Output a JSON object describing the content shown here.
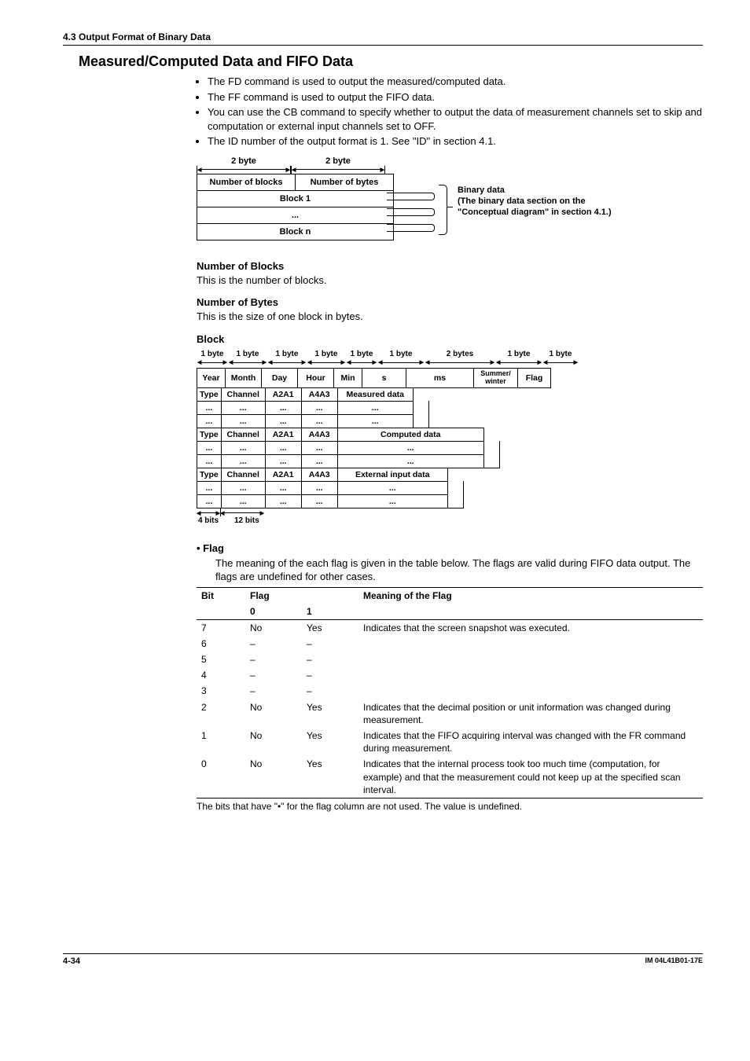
{
  "section_header": "4.3  Output Format of Binary Data",
  "title": "Measured/Computed Data and FIFO Data",
  "bullets": [
    "The FD command is used to output the measured/computed data.",
    "The FF command is used to output the FIFO data.",
    "You can use the CB command to specify whether to output the data of measurement channels set to skip and computation or external input channels set to OFF.",
    "The ID number of the output format is 1.  See \"ID\" in section 4.1."
  ],
  "diagram1": {
    "dim1": "2 byte",
    "dim2": "2 byte",
    "cells": {
      "num_blocks": "Number of blocks",
      "num_bytes": "Number of bytes",
      "block1": "Block 1",
      "dots": "...",
      "blockn": "Block n"
    },
    "brace_label": "Binary data\n(The binary data section on the \"Conceptual diagram\" in section 4.1.)"
  },
  "num_blocks_head": "Number of Blocks",
  "num_blocks_text": "This is the number of blocks.",
  "num_bytes_head": "Number of Bytes",
  "num_bytes_text": "This is the size of one block in bytes.",
  "block_head": "Block",
  "bd_dims": [
    "1 byte",
    "1 byte",
    "1 byte",
    "1 byte",
    "1 byte",
    "1 byte",
    "2 bytes",
    "1 byte",
    "1 byte"
  ],
  "bd_header": [
    "Year",
    "Month",
    "Day",
    "Hour",
    "Min",
    "s",
    "ms",
    "Summer/\nwinter",
    "Flag"
  ],
  "bd_rows": [
    [
      "Type",
      "Channel",
      "A2A1",
      "A4A3",
      "Measured data"
    ],
    [
      "...",
      "...",
      "...",
      "...",
      "..."
    ],
    [
      "...",
      "...",
      "...",
      "...",
      "..."
    ],
    [
      "Type",
      "Channel",
      "A2A1",
      "A4A3",
      "Computed data"
    ],
    [
      "...",
      "...",
      "...",
      "...",
      "..."
    ],
    [
      "...",
      "...",
      "...",
      "...",
      "..."
    ],
    [
      "Type",
      "Channel",
      "A2A1",
      "A4A3",
      "External input data"
    ],
    [
      "...",
      "...",
      "...",
      "...",
      "..."
    ],
    [
      "...",
      "...",
      "...",
      "...",
      "..."
    ]
  ],
  "bd_bottom_left": "4 bits",
  "bd_bottom_right": "12 bits",
  "flag_head": "•  Flag",
  "flag_intro": "The meaning of the each flag is given in the table below.  The flags are valid during FIFO data output.  The flags are undefined for other cases.",
  "flag_table": {
    "cols": [
      "Bit",
      "Flag",
      "",
      "Meaning of the Flag"
    ],
    "subcols": [
      "",
      "0",
      "1",
      ""
    ],
    "rows": [
      {
        "bit": "7",
        "f0": "No",
        "f1": "Yes",
        "meaning": "Indicates that the screen snapshot was executed."
      },
      {
        "bit": "6",
        "f0": "–",
        "f1": "–",
        "meaning": ""
      },
      {
        "bit": "5",
        "f0": "–",
        "f1": "–",
        "meaning": ""
      },
      {
        "bit": "4",
        "f0": "–",
        "f1": "–",
        "meaning": ""
      },
      {
        "bit": "3",
        "f0": "–",
        "f1": "–",
        "meaning": ""
      },
      {
        "bit": "2",
        "f0": "No",
        "f1": "Yes",
        "meaning": "Indicates that the decimal position or unit information was changed during measurement."
      },
      {
        "bit": "1",
        "f0": "No",
        "f1": "Yes",
        "meaning": "Indicates that the FIFO acquiring interval was changed with the FR command during measurement."
      },
      {
        "bit": "0",
        "f0": "No",
        "f1": "Yes",
        "meaning": "Indicates that the internal process took too much time (computation, for example) and that the measurement could not keep up at the specified scan interval."
      }
    ]
  },
  "flag_footnote": "The bits that have \"•\" for the flag column are not used.  The value is undefined.",
  "footer_left": "4-34",
  "footer_right": "IM 04L41B01-17E",
  "chart_data": {
    "type": "table",
    "title": "Flag meanings",
    "columns": [
      "Bit",
      "Flag 0",
      "Flag 1",
      "Meaning of the Flag"
    ],
    "rows": [
      [
        7,
        "No",
        "Yes",
        "Indicates that the screen snapshot was executed."
      ],
      [
        6,
        "–",
        "–",
        ""
      ],
      [
        5,
        "–",
        "–",
        ""
      ],
      [
        4,
        "–",
        "–",
        ""
      ],
      [
        3,
        "–",
        "–",
        ""
      ],
      [
        2,
        "No",
        "Yes",
        "Indicates that the decimal position or unit information was changed during measurement."
      ],
      [
        1,
        "No",
        "Yes",
        "Indicates that the FIFO acquiring interval was changed with the FR command during measurement."
      ],
      [
        0,
        "No",
        "Yes",
        "Indicates that the internal process took too much time (computation, for example) and that the measurement could not keep up at the specified scan interval."
      ]
    ]
  }
}
